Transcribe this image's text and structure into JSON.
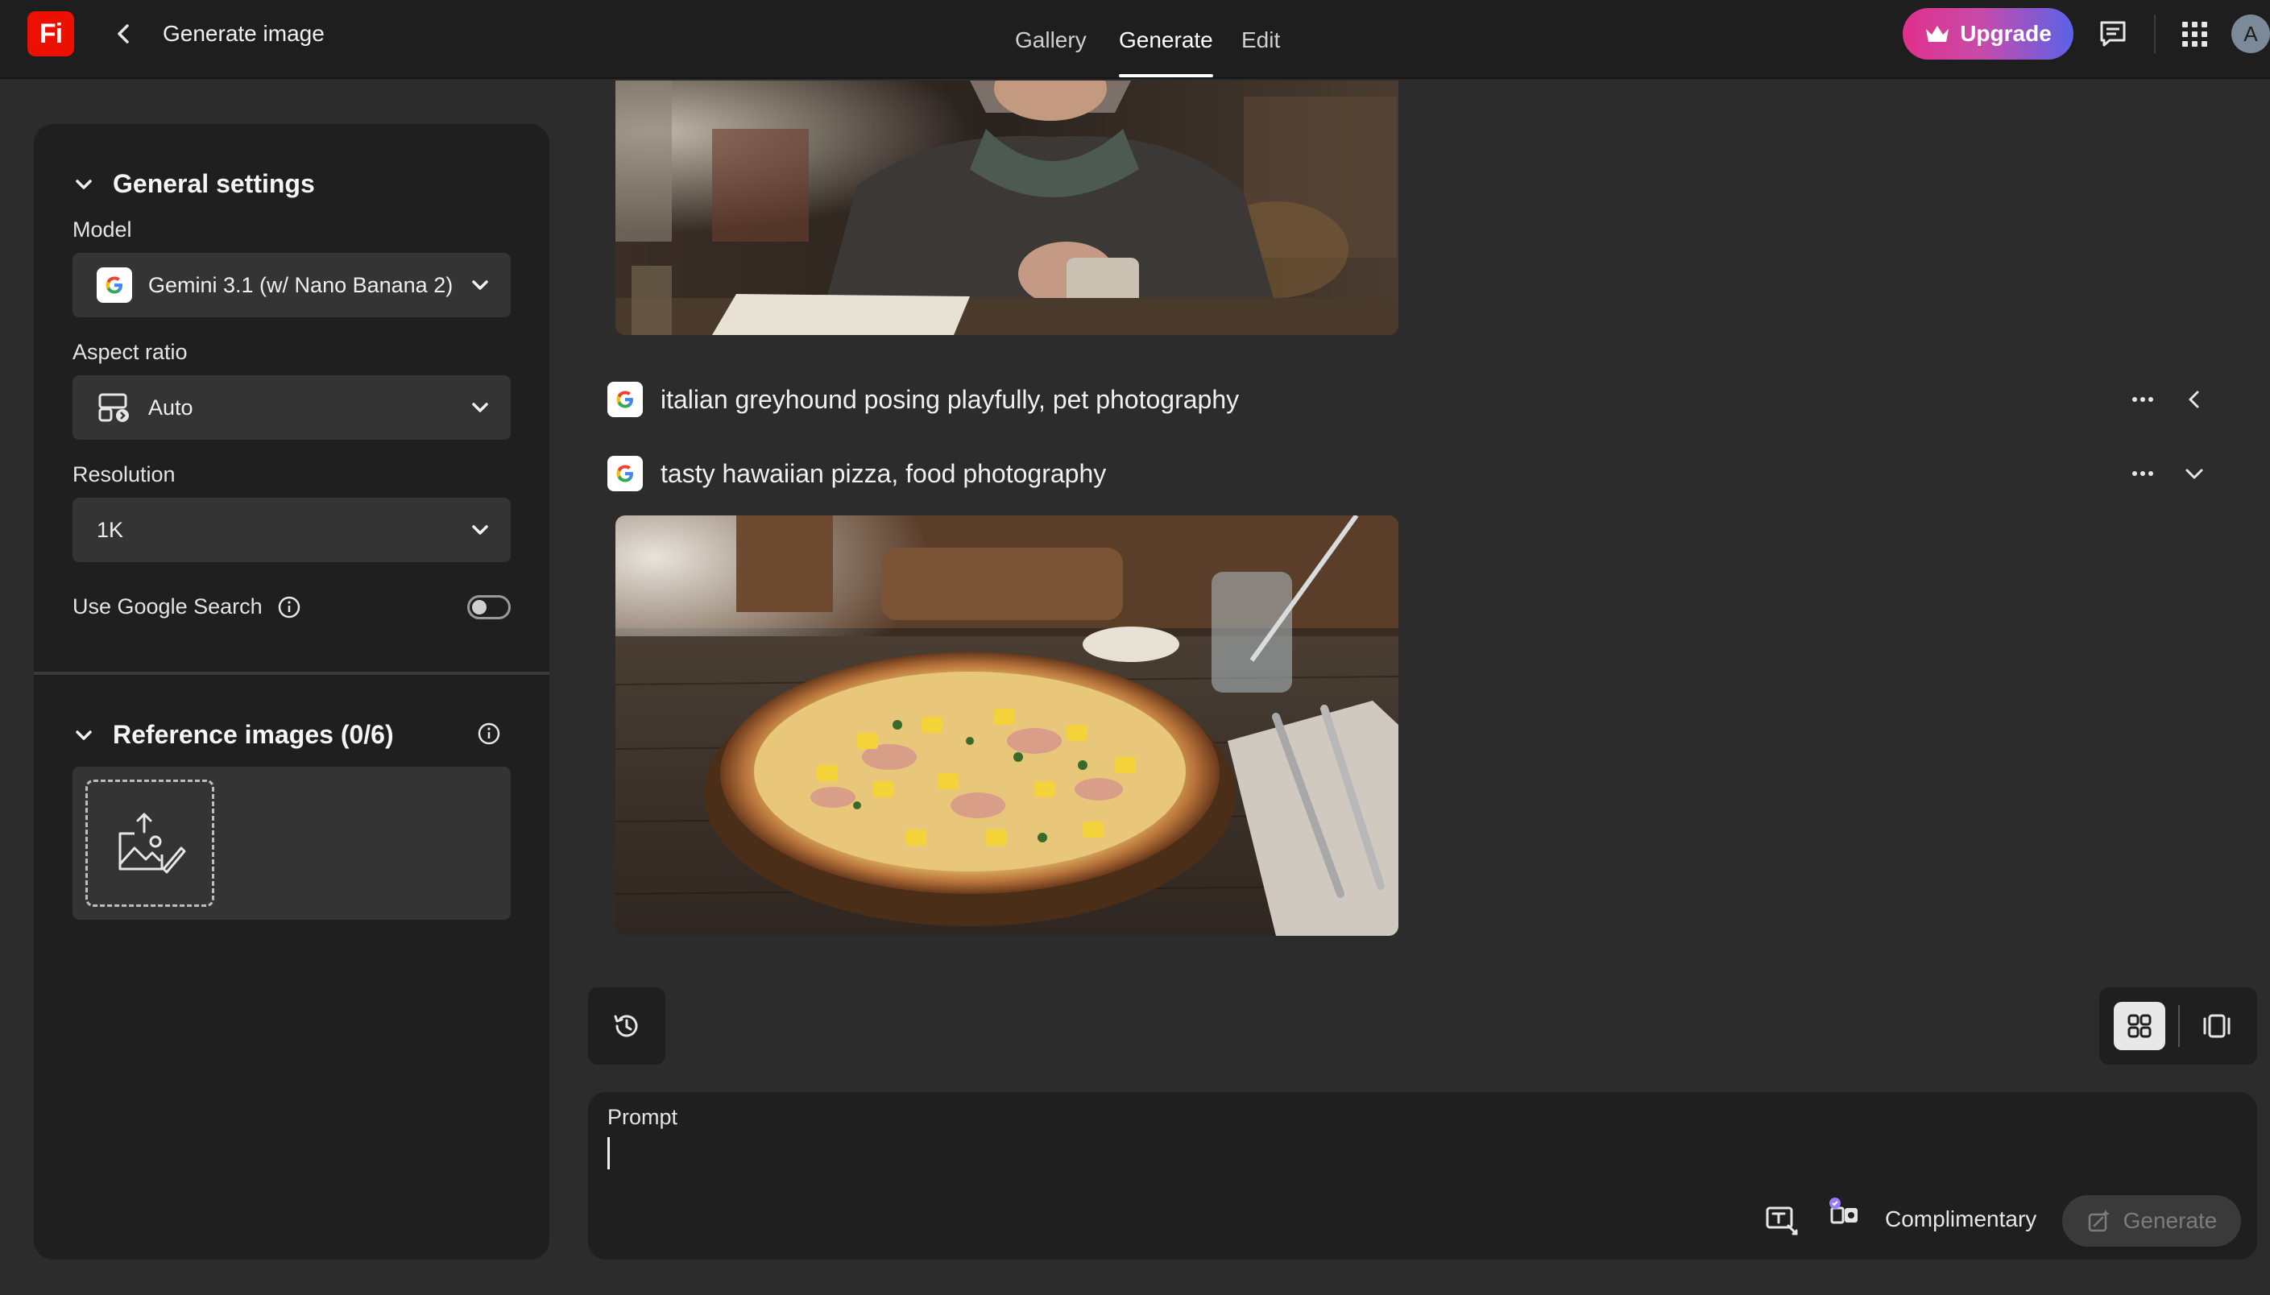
{
  "header": {
    "logo_text": "Fi",
    "page_title": "Generate image",
    "tabs": [
      {
        "label": "Gallery",
        "active": false
      },
      {
        "label": "Generate",
        "active": true
      },
      {
        "label": "Edit",
        "active": false
      }
    ],
    "upgrade_label": "Upgrade",
    "avatar_initial": "A",
    "accent_gradient": [
      "#e0308c",
      "#5a63e8"
    ]
  },
  "settings": {
    "general_title": "General settings",
    "model_label": "Model",
    "model_value": "Gemini 3.1 (w/ Nano Banana 2)",
    "aspect_label": "Aspect ratio",
    "aspect_value": "Auto",
    "resolution_label": "Resolution",
    "resolution_value": "1K",
    "google_search_label": "Use Google Search",
    "google_search_enabled": false,
    "reference_title": "Reference images (0/6)"
  },
  "feed": {
    "items": [
      {
        "prompt": "",
        "image": "woman-with-mug-photo",
        "collapsed": false
      },
      {
        "prompt": "italian greyhound posing playfully, pet photography",
        "collapsed": true
      },
      {
        "prompt": "tasty hawaiian pizza, food photography",
        "image": "hawaiian-pizza-photo",
        "collapsed": false
      }
    ]
  },
  "prompt": {
    "label": "Prompt",
    "value": "",
    "complimentary_label": "Complimentary",
    "generate_label": "Generate"
  },
  "icons": {
    "back": "chevron-left-icon",
    "upgrade": "crown-icon",
    "feedback": "chat-bubble-icon",
    "apps": "app-grid-icon",
    "history": "history-icon",
    "grid_view": "grid-view-icon",
    "single_view": "single-view-icon"
  }
}
